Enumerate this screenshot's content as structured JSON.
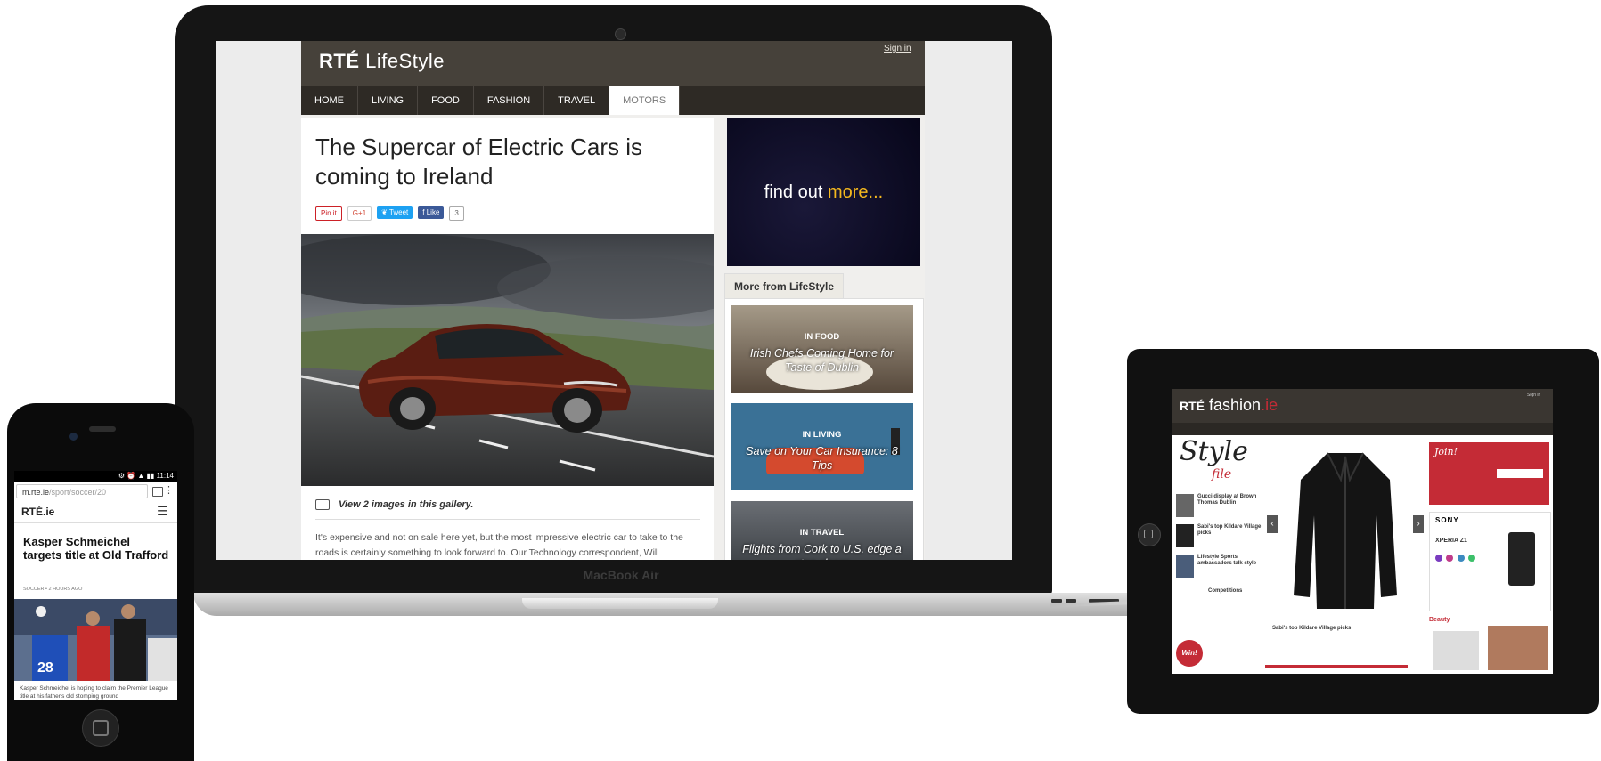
{
  "laptop": {
    "brand": "MacBook Air",
    "site": {
      "logo_main": "RTÉ",
      "logo_section": "LifeStyle",
      "signin": "Sign in",
      "nav": [
        "HOME",
        "LIVING",
        "FOOD",
        "FASHION",
        "TRAVEL",
        "MOTORS"
      ],
      "nav_active": "MOTORS",
      "article": {
        "title": "The Supercar of Electric Cars is coming to Ireland",
        "share": {
          "pin": "Pin it",
          "gplus": "G+1",
          "tweet": "Tweet",
          "like": "Like",
          "like_count": "3"
        },
        "gallery_text": "View 2 images in this gallery.",
        "body": "It's expensive and not on sale here yet, but the most impressive electric car to take to the roads is certainly something to look forward to. Our Technology correspondent, Will"
      },
      "sidebar": {
        "ad_text_a": "find out",
        "ad_text_b": "more...",
        "more_heading": "More from LifeStyle",
        "cards": [
          {
            "category": "IN FOOD",
            "title": "Irish Chefs Coming Home for Taste of Dublin"
          },
          {
            "category": "IN LIVING",
            "title": "Save on Your Car Insurance: 8 Tips"
          },
          {
            "category": "IN TRAVEL",
            "title": "Flights from Cork to U.S. edge a step closer"
          }
        ]
      }
    }
  },
  "phone": {
    "status_time": "11:14",
    "url_host": "m.rte.ie",
    "url_path": "/sport/soccer/20",
    "logo": "RTÉ.ie",
    "headline": "Kasper Schmeichel targets title at Old Trafford",
    "meta": "SOCCER • 2 HOURS AGO",
    "jersey_number": "28",
    "caption": "Kasper Schmeichel is hoping to claim the Premier League title at his father's old stomping ground"
  },
  "tablet": {
    "logo_a": "RTÉ",
    "logo_b": "fashion",
    "logo_c": ".ie",
    "signin": "Sign in",
    "style": "Style",
    "file": "file",
    "left_items": [
      "Gucci display at Brown Thomas Dublin",
      "Sabi's top Kildare Village picks",
      "Lifestyle Sports ambassadors talk style",
      "Competitions"
    ],
    "win": "Win!",
    "caption": "Sabi's top Kildare Village picks",
    "join": "Join!",
    "sony": "SONY",
    "xperia": "XPERIA Z1",
    "beauty": "Beauty"
  },
  "colors": {
    "rte_header": "#46413a",
    "rte_nav": "#2e2a25",
    "accent_gold": "#f5b91e",
    "fashion_red": "#c42b36"
  }
}
